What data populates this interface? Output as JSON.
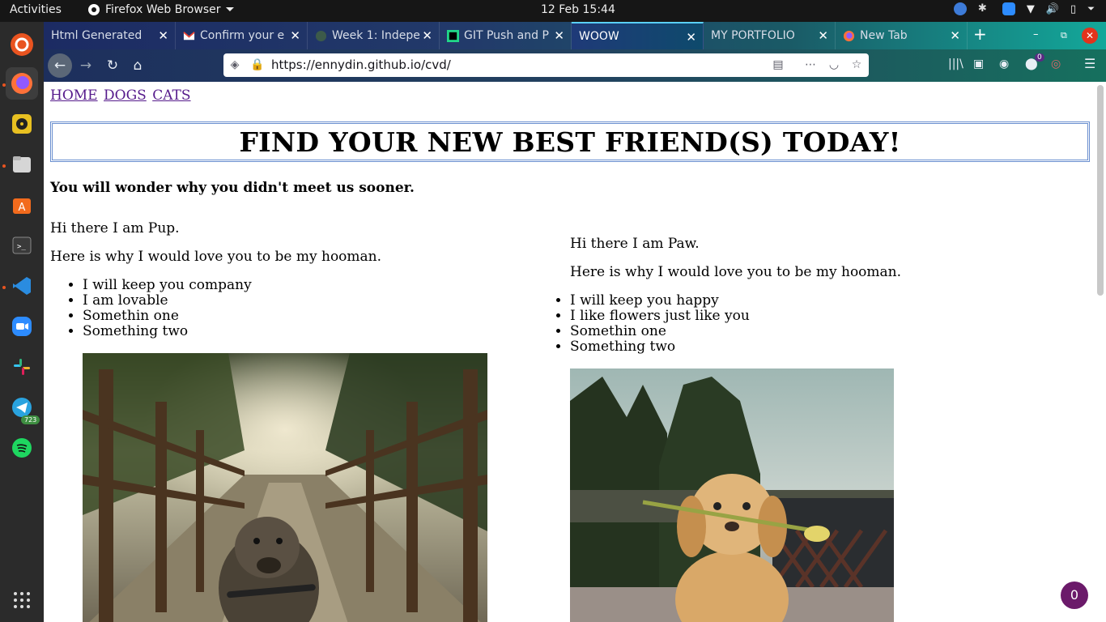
{
  "topbar": {
    "activities": "Activities",
    "app_name": "Firefox Web Browser",
    "clock": "12 Feb  15:44"
  },
  "dock": {
    "telegram_badge": "723"
  },
  "browser": {
    "tabs": [
      {
        "title": "Html Generated",
        "favicon": "generic-page-icon"
      },
      {
        "title": "Confirm your e",
        "favicon": "gmail-icon"
      },
      {
        "title": "Week 1: Indepe",
        "favicon": "github-icon"
      },
      {
        "title": "GIT Push and P",
        "favicon": "pycharm-icon"
      },
      {
        "title": "WOOW",
        "favicon": "none",
        "active": true
      },
      {
        "title": "MY PORTFOLIO",
        "favicon": "none"
      },
      {
        "title": "New Tab",
        "favicon": "firefox-icon"
      }
    ],
    "url": "https://ennydin.github.io/cvd/",
    "extension_badge": "0"
  },
  "page": {
    "menu": [
      "HOME",
      "DOGS",
      "CATS"
    ],
    "headline": "FIND YOUR NEW BEST FRIEND(S) TODAY!",
    "subhead": "You will wonder why you didn't meet us sooner.",
    "pets": [
      {
        "greeting": "Hi there I am Pup.",
        "reason": "Here is why I would love you to be my hooman.",
        "items": [
          "I will keep you company",
          "I am lovable",
          "Somethin one",
          "Something two"
        ],
        "photo": "dog-on-bridge-photo"
      },
      {
        "greeting": "Hi there I am Paw.",
        "reason": "Here is why I would love you to be my hooman.",
        "items": [
          "I will keep you happy",
          "I like flowers just like you",
          "Somethin one",
          "Something two"
        ],
        "photo": "puppy-with-tulip-photo"
      }
    ],
    "chat_count": "0"
  }
}
